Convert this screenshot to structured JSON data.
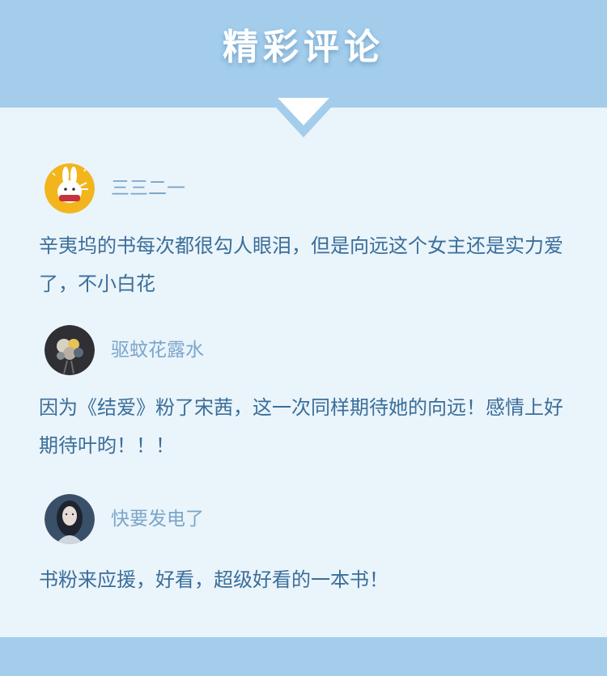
{
  "header": {
    "title": "精彩评论"
  },
  "comments": [
    {
      "user": "三三二一",
      "avatar_icon": "bunny-avatar-icon",
      "text": "辛夷坞的书每次都很勾人眼泪，但是向远这个女主还是实力爱了，不小白花"
    },
    {
      "user": "驱蚊花露水",
      "avatar_icon": "flower-bouquet-avatar-icon",
      "text": "因为《结爱》粉了宋茜，这一次同样期待她的向远！感情上好期待叶昀！！！"
    },
    {
      "user": "快要发电了",
      "avatar_icon": "girl-portrait-avatar-icon",
      "text": "书粉来应援，好看，超级好看的一本书！"
    }
  ],
  "colors": {
    "header_bg": "#a3cdeb",
    "page_bg": "#eaf4fb",
    "username": "#7aa6c8",
    "comment_text": "#3a6e99"
  }
}
